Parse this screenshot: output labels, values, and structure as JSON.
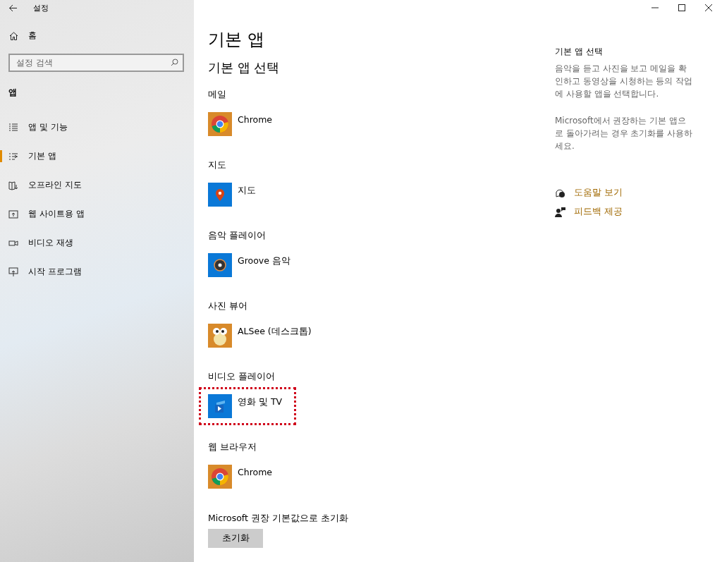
{
  "window": {
    "title": "설정"
  },
  "sidebar": {
    "home": "홈",
    "search": {
      "placeholder": "설정 검색"
    },
    "section": "앱",
    "items": [
      {
        "label": "앱 및 기능",
        "selected": false
      },
      {
        "label": "기본 앱",
        "selected": true
      },
      {
        "label": "오프라인 지도",
        "selected": false
      },
      {
        "label": "웹 사이트용 앱",
        "selected": false
      },
      {
        "label": "비디오 재생",
        "selected": false
      },
      {
        "label": "시작 프로그램",
        "selected": false
      }
    ]
  },
  "main": {
    "title": "기본 앱",
    "subtitle": "기본 앱 선택",
    "defaults": [
      {
        "category": "메일",
        "app": "Chrome",
        "kind": "chrome",
        "highlighted": false
      },
      {
        "category": "지도",
        "app": "지도",
        "kind": "maps",
        "highlighted": false
      },
      {
        "category": "음악 플레이어",
        "app": "Groove 음악",
        "kind": "music",
        "highlighted": false
      },
      {
        "category": "사진 뷰어",
        "app": "ALSee (데스크톱)",
        "kind": "photo",
        "highlighted": false
      },
      {
        "category": "비디오 플레이어",
        "app": "영화 및 TV",
        "kind": "video",
        "highlighted": true
      },
      {
        "category": "웹 브라우저",
        "app": "Chrome",
        "kind": "chrome",
        "highlighted": false
      }
    ],
    "reset": {
      "label": "Microsoft 권장 기본값으로 초기화",
      "button": "초기화"
    }
  },
  "aside": {
    "title": "기본 앱 선택",
    "paragraphs": [
      "음악을 듣고 사진을 보고 메일을 확인하고 동영상을 시청하는 등의 작업에 사용할 앱을 선택합니다.",
      "Microsoft에서 권장하는 기본 앱으로 돌아가려는 경우 초기화를 사용하세요."
    ],
    "links": [
      "도움말 보기",
      "피드백 제공"
    ]
  }
}
